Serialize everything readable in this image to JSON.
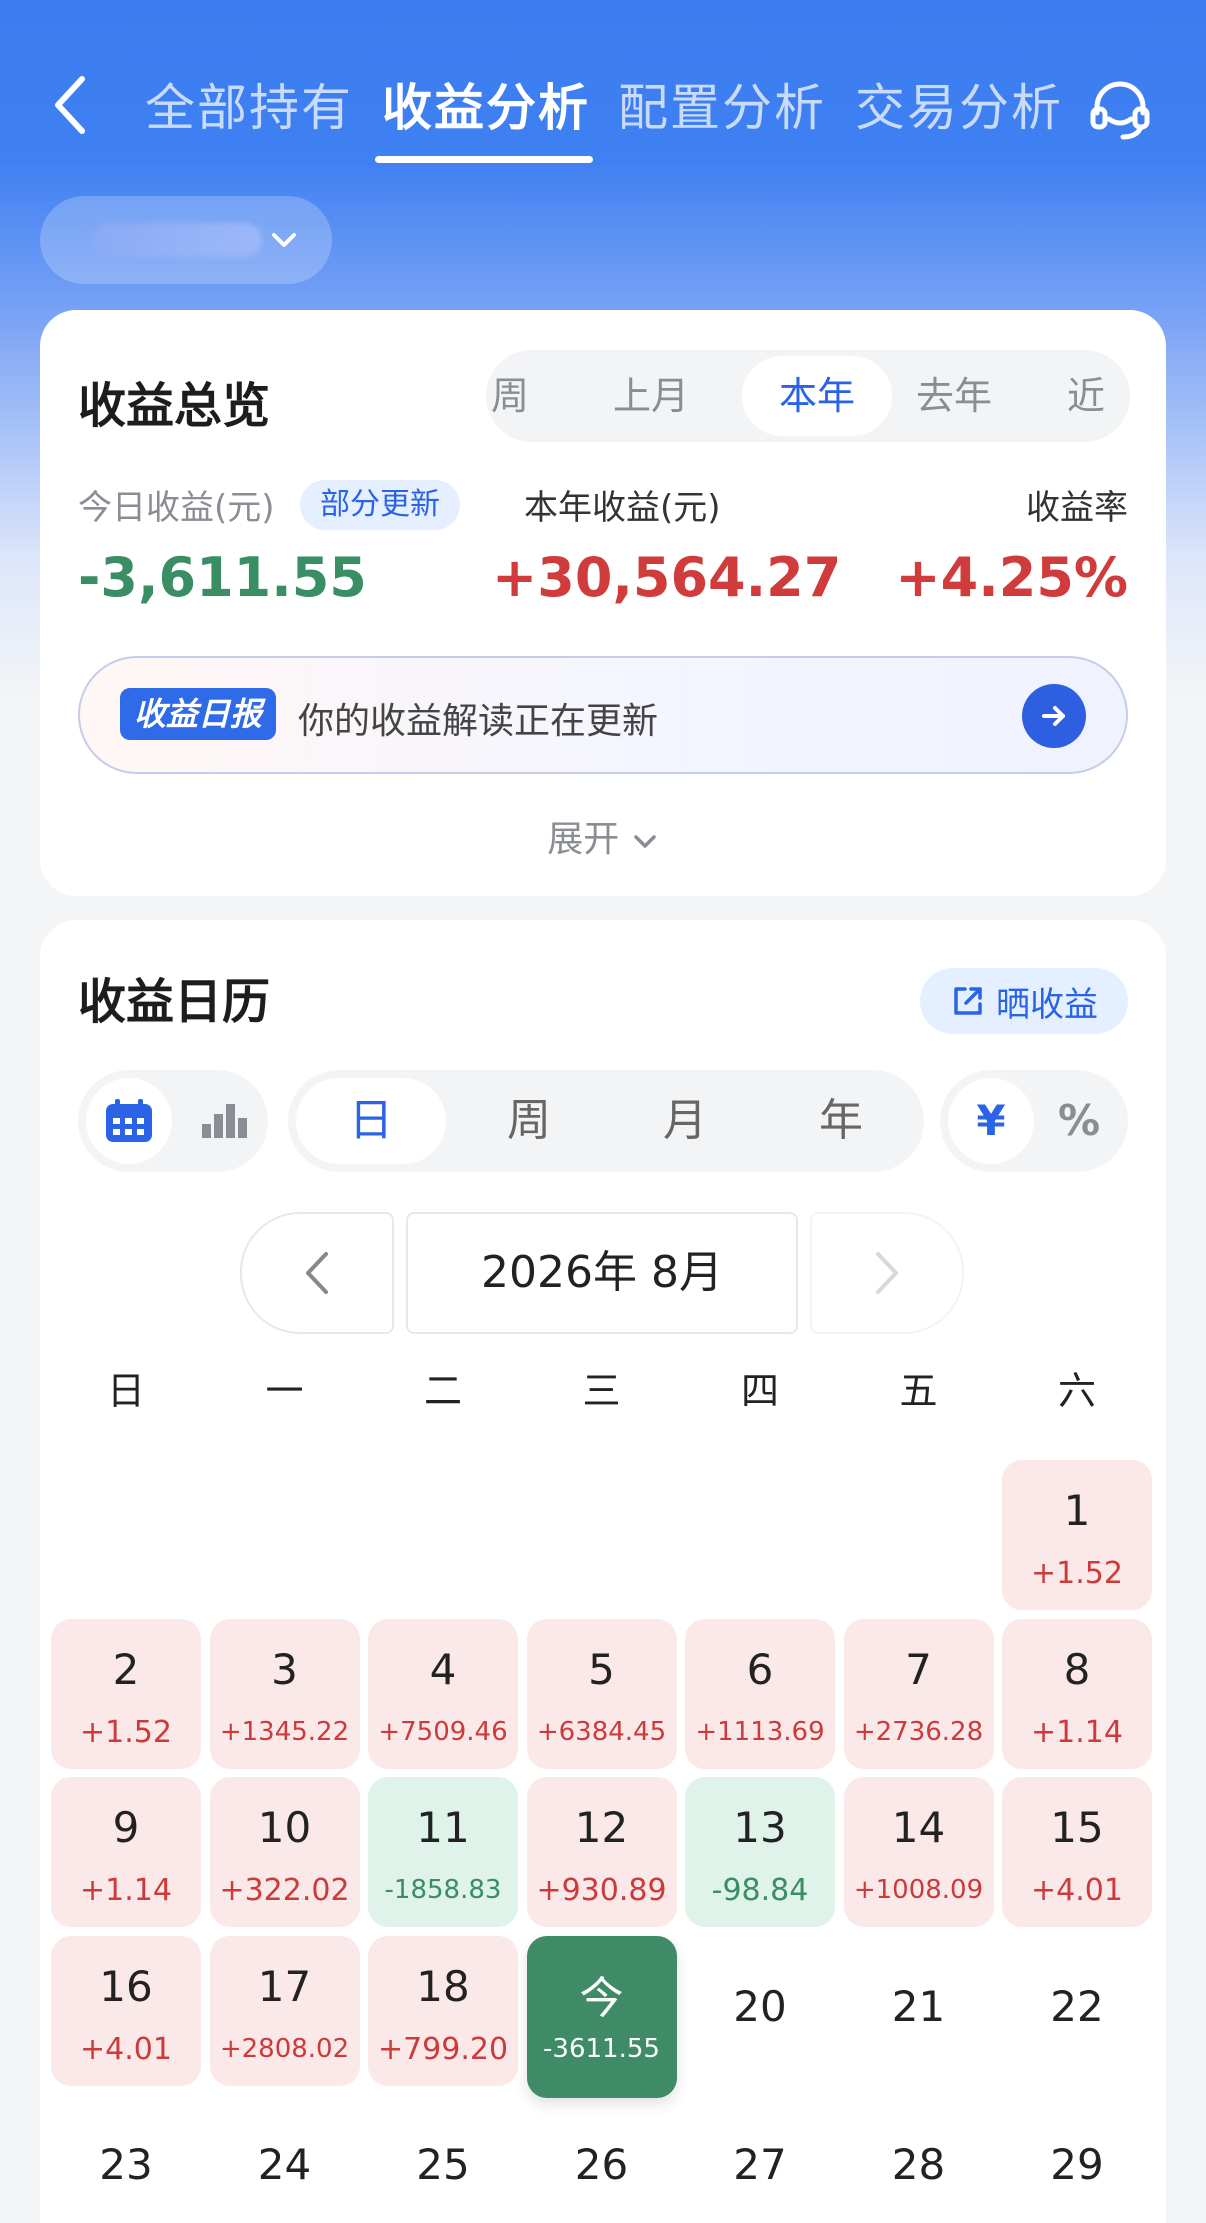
{
  "header": {
    "tabs": [
      {
        "label": "全部持有",
        "active": false
      },
      {
        "label": "收益分析",
        "active": true
      },
      {
        "label": "配置分析",
        "active": false
      },
      {
        "label": "交易分析",
        "active": false
      }
    ],
    "back_icon": "chevron-left-icon",
    "service_icon": "headset-icon"
  },
  "account_selector": {
    "icon": "chevron-down-icon"
  },
  "overview": {
    "title": "收益总览",
    "periods": [
      "周",
      "上月",
      "本年",
      "去年",
      "近"
    ],
    "active_period": "本年",
    "today_label": "今日收益(元)",
    "today_badge": "部分更新",
    "today_value": "-3,611.55",
    "year_label": "本年收益(元)",
    "year_value": "+30,564.27",
    "rate_label": "收益率",
    "rate_value": "+4.25%",
    "report_tag": "收益日报",
    "report_text": "你的收益解读正在更新",
    "expand_label": "展开"
  },
  "calendar": {
    "title": "收益日历",
    "share_label": "晒收益",
    "granularity": [
      "日",
      "周",
      "月",
      "年"
    ],
    "active_granularity": "日",
    "units": [
      "¥",
      "%"
    ],
    "active_unit": "¥",
    "month_label": "2026年 8月",
    "weekdays": [
      "日",
      "一",
      "二",
      "三",
      "四",
      "五",
      "六"
    ],
    "days": [
      {
        "day": "1",
        "value": "+1.52",
        "state": "pos"
      },
      {
        "day": "2",
        "value": "+1.52",
        "state": "pos"
      },
      {
        "day": "3",
        "value": "+1345.22",
        "state": "pos"
      },
      {
        "day": "4",
        "value": "+7509.46",
        "state": "pos"
      },
      {
        "day": "5",
        "value": "+6384.45",
        "state": "pos"
      },
      {
        "day": "6",
        "value": "+1113.69",
        "state": "pos"
      },
      {
        "day": "7",
        "value": "+2736.28",
        "state": "pos"
      },
      {
        "day": "8",
        "value": "+1.14",
        "state": "pos"
      },
      {
        "day": "9",
        "value": "+1.14",
        "state": "pos"
      },
      {
        "day": "10",
        "value": "+322.02",
        "state": "pos"
      },
      {
        "day": "11",
        "value": "-1858.83",
        "state": "neg"
      },
      {
        "day": "12",
        "value": "+930.89",
        "state": "pos"
      },
      {
        "day": "13",
        "value": "-98.84",
        "state": "neg"
      },
      {
        "day": "14",
        "value": "+1008.09",
        "state": "pos"
      },
      {
        "day": "15",
        "value": "+4.01",
        "state": "pos"
      },
      {
        "day": "16",
        "value": "+4.01",
        "state": "pos"
      },
      {
        "day": "17",
        "value": "+2808.02",
        "state": "pos"
      },
      {
        "day": "18",
        "value": "+799.20",
        "state": "pos"
      },
      {
        "day": "今",
        "value": "-3611.55",
        "state": "today"
      },
      {
        "day": "20",
        "value": "",
        "state": "empty"
      },
      {
        "day": "21",
        "value": "",
        "state": "empty"
      },
      {
        "day": "22",
        "value": "",
        "state": "empty"
      },
      {
        "day": "23",
        "value": "",
        "state": "empty"
      },
      {
        "day": "24",
        "value": "",
        "state": "empty"
      },
      {
        "day": "25",
        "value": "",
        "state": "empty"
      },
      {
        "day": "26",
        "value": "",
        "state": "empty"
      },
      {
        "day": "27",
        "value": "",
        "state": "empty"
      },
      {
        "day": "28",
        "value": "",
        "state": "empty"
      },
      {
        "day": "29",
        "value": "",
        "state": "empty"
      }
    ],
    "colors": {
      "positive": "#cc3b3b",
      "negative": "#3a8e63",
      "accent": "#2a63e6"
    }
  }
}
